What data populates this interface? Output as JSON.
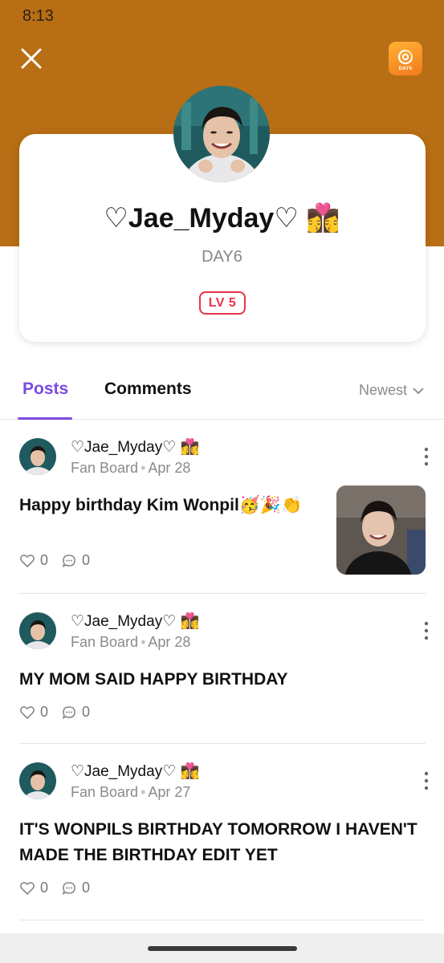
{
  "status_bar": {
    "time": "8:13"
  },
  "header": {
    "close_icon": "close-icon",
    "app_badge_text": "DAY6",
    "accent_color": "#b86e14"
  },
  "profile": {
    "name": "♡Jae_Myday♡ 👩‍❤️‍💋‍👩",
    "group": "DAY6",
    "level": "LV 5"
  },
  "tabs": [
    {
      "label": "Posts",
      "active": true
    },
    {
      "label": "Comments",
      "active": false
    }
  ],
  "sort": {
    "label": "Newest"
  },
  "posts": [
    {
      "author": "♡Jae_Myday♡ 👩‍❤️‍💋‍👩",
      "board": "Fan Board",
      "date": "Apr 28",
      "title": "Happy birthday Kim Wonpil🥳🎉👏",
      "likes": "0",
      "comments": "0",
      "has_image": true
    },
    {
      "author": "♡Jae_Myday♡ 👩‍❤️‍💋‍👩",
      "board": "Fan Board",
      "date": "Apr 28",
      "title": "MY MOM SAID HAPPY BIRTHDAY",
      "likes": "0",
      "comments": "0",
      "has_image": false
    },
    {
      "author": "♡Jae_Myday♡ 👩‍❤️‍💋‍👩",
      "board": "Fan Board",
      "date": "Apr 27",
      "title": "IT'S WONPILS BIRTHDAY TOMORROW I HAVEN'T MADE THE BIRTHDAY EDIT YET",
      "likes": "0",
      "comments": "0",
      "has_image": false
    }
  ]
}
